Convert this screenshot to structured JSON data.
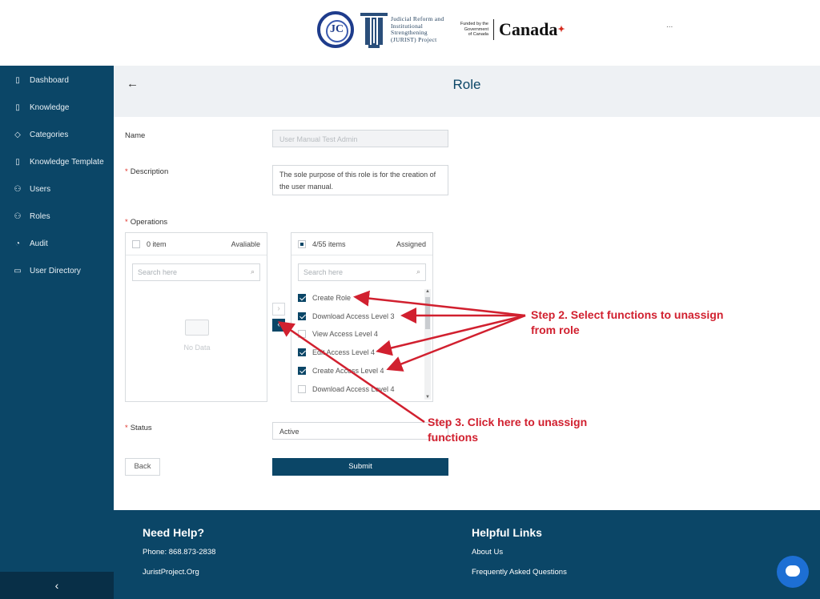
{
  "header": {
    "seal_text": "JC",
    "jurist_lines": [
      "Judicial Reform and",
      "Institutional",
      "Strengthening",
      "(JURIST) Project"
    ],
    "funded_lines": [
      "Funded by the",
      "Government",
      "of Canada"
    ],
    "canada_word": "Canada",
    "more": "..."
  },
  "sidebar": {
    "items": [
      {
        "label": "Dashboard",
        "icon": "document-icon",
        "glyph": "▯"
      },
      {
        "label": "Knowledge",
        "icon": "document-icon",
        "glyph": "▯"
      },
      {
        "label": "Categories",
        "icon": "tag-icon",
        "glyph": "◇"
      },
      {
        "label": "Knowledge Template",
        "icon": "template-icon",
        "glyph": "▯"
      },
      {
        "label": "Users",
        "icon": "user-icon",
        "glyph": "⚇"
      },
      {
        "label": "Roles",
        "icon": "roles-icon",
        "glyph": "⚇"
      },
      {
        "label": "Audit",
        "icon": "audit-icon",
        "glyph": "◔"
      },
      {
        "label": "User Directory",
        "icon": "folder-icon",
        "glyph": "▭"
      }
    ],
    "collapse": "‹"
  },
  "page": {
    "back": "←",
    "title": "Role"
  },
  "form": {
    "name_label": "Name",
    "name_value": "User Manual Test Admin",
    "description_label": "Description",
    "description_value": "The sole purpose of this role is for the creation of the user manual.",
    "operations_label": "Operations",
    "status_label": "Status",
    "status_value": "Active",
    "required_mark": "*",
    "back_button": "Back",
    "submit_button": "Submit"
  },
  "transfer": {
    "available": {
      "count": "0 item",
      "title": "Avaliable",
      "search_placeholder": "Search here",
      "empty": "No Data"
    },
    "assigned": {
      "count": "4/55 items",
      "title": "Assigned",
      "search_placeholder": "Search here",
      "items": [
        {
          "label": "Create Role",
          "checked": true
        },
        {
          "label": "Download Access Level 3",
          "checked": true
        },
        {
          "label": "View Access Level 4",
          "checked": false
        },
        {
          "label": "Edit Access Level 4",
          "checked": true
        },
        {
          "label": "Create Access Level 4",
          "checked": true
        },
        {
          "label": "Download Access Level 4",
          "checked": false
        }
      ]
    },
    "move_right": "›",
    "move_left": "‹"
  },
  "annotations": {
    "step2": "Step 2. Select functions to unassign from role",
    "step3": "Step 3. Click here to unassign functions",
    "color": "#d1202f"
  },
  "footer": {
    "help_title": "Need Help?",
    "phone": "Phone: 868.873-2838",
    "site": "JuristProject.Org",
    "links_title": "Helpful Links",
    "about": "About Us",
    "faq": "Frequently Asked Questions"
  },
  "colors": {
    "brand": "#0b4667",
    "chat": "#1d6fd4"
  }
}
